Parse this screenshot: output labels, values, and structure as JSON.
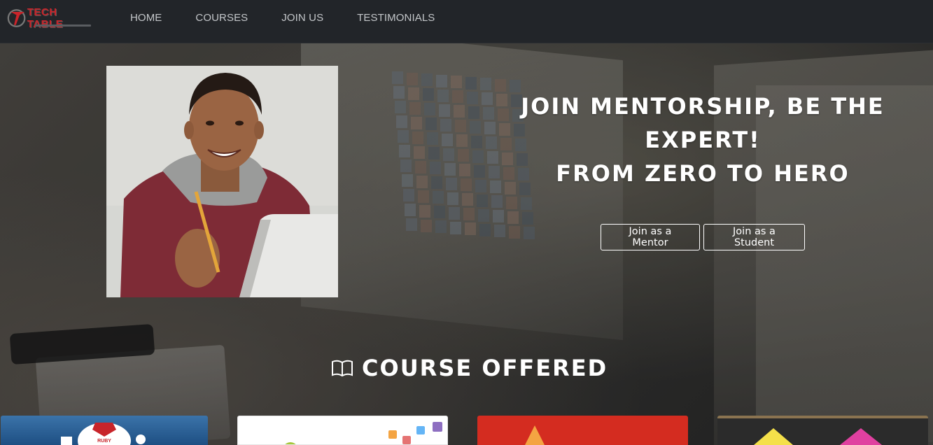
{
  "brand": {
    "name": "TECH TABLE"
  },
  "nav": {
    "links": [
      "HOME",
      "COURSES",
      "JOIN US",
      "TESTIMONIALS"
    ]
  },
  "hero": {
    "headline_line1": "JOIN MENTORSHIP, BE THE",
    "headline_line2": "EXPERT!",
    "headline_line3": "FROM ZERO TO HERO",
    "buttons": {
      "mentor": "Join as a Mentor",
      "student": "Join as a Student"
    }
  },
  "courses": {
    "title": "COURSE OFFERED",
    "icon": "book-open-icon",
    "card_1_text": "RUBY"
  },
  "colors": {
    "navbar_bg": "#222529",
    "nav_text": "#c3c6c9",
    "brand_red": "#c9242a",
    "hero_text": "#ffffff"
  }
}
